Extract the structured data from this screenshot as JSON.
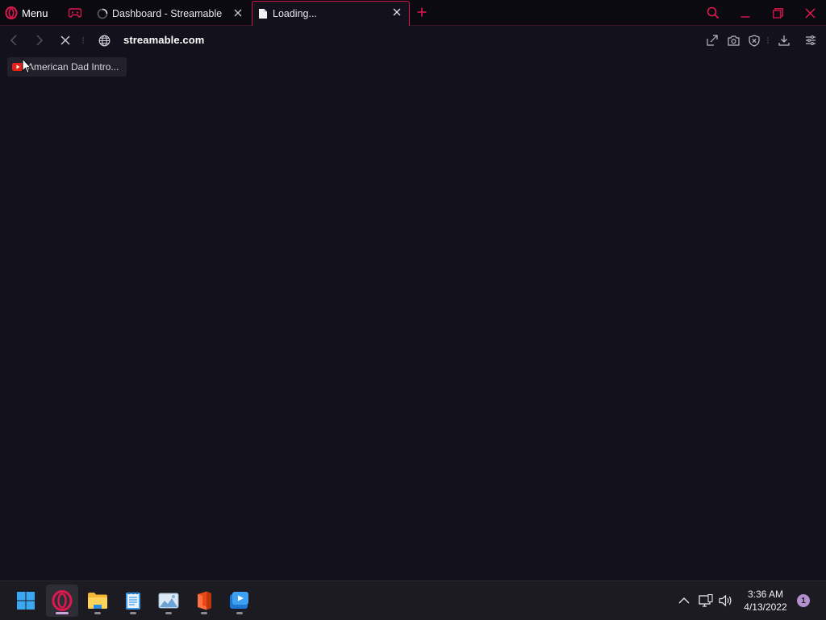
{
  "browser": {
    "menu_label": "Menu",
    "tabs": [
      {
        "title": "Dashboard - Streamable",
        "state": "loading"
      },
      {
        "title": "Loading...",
        "state": "active"
      }
    ],
    "address": {
      "url": "streamable.com"
    },
    "bookmarks": [
      {
        "label": "American Dad Intro...",
        "icon": "youtube-icon"
      }
    ],
    "accent_color": "#e0184f"
  },
  "taskbar": {
    "apps": [
      {
        "name": "start-icon"
      },
      {
        "name": "opera-gx-icon",
        "active": true
      },
      {
        "name": "file-explorer-icon"
      },
      {
        "name": "notepad-icon"
      },
      {
        "name": "photos-icon"
      },
      {
        "name": "office-icon"
      },
      {
        "name": "media-player-icon"
      }
    ],
    "clock": {
      "time": "3:36 AM",
      "date": "4/13/2022"
    },
    "notification_count": "1"
  }
}
